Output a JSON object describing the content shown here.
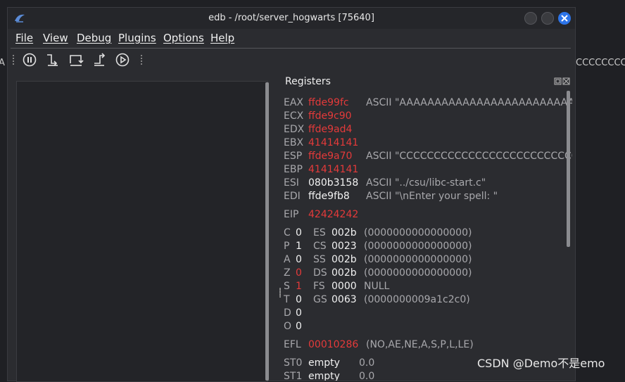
{
  "window": {
    "title": "edb - /root/server_hogwarts [75640]"
  },
  "background": {
    "left_text": "A",
    "right_text": "CCCCCCCCC"
  },
  "menu": [
    "File",
    "View",
    "Debug",
    "Plugins",
    "Options",
    "Help"
  ],
  "toolbar": [
    {
      "icon": "pause-icon"
    },
    {
      "icon": "step-into-icon"
    },
    {
      "icon": "step-over-icon"
    },
    {
      "icon": "step-out-icon"
    },
    {
      "icon": "run-icon"
    }
  ],
  "registers": {
    "title": "Registers",
    "general": [
      {
        "name": "EAX",
        "value": "ffde99fc",
        "comment": "ASCII \"AAAAAAAAAAAAAAAAAAAAAAAAAAAAAAA"
      },
      {
        "name": "ECX",
        "value": "ffde9c90",
        "comment": ""
      },
      {
        "name": "EDX",
        "value": "ffde9ad4",
        "comment": ""
      },
      {
        "name": "EBX",
        "value": "41414141",
        "comment": ""
      },
      {
        "name": "ESP",
        "value": "ffde9a70",
        "comment": "ASCII \"CCCCCCCCCCCCCCCCCCCCCCCCCCCCCC"
      },
      {
        "name": "EBP",
        "value": "41414141",
        "comment": ""
      },
      {
        "name": "ESI",
        "value": "080b3158",
        "comment": "ASCII \"../csu/libc-start.c\""
      },
      {
        "name": "EDI",
        "value": "ffde9fb8",
        "comment": "ASCII \"\\nEnter your spell: \""
      }
    ],
    "eip": {
      "name": "EIP",
      "value": "42424242"
    },
    "flags": [
      {
        "flag": "C",
        "value": "0",
        "seg": "ES",
        "seg_value": "002b",
        "desc": "(0000000000000000)"
      },
      {
        "flag": "P",
        "value": "1",
        "seg": "CS",
        "seg_value": "0023",
        "desc": "(0000000000000000)"
      },
      {
        "flag": "A",
        "value": "0",
        "seg": "SS",
        "seg_value": "002b",
        "desc": "(0000000000000000)"
      },
      {
        "flag": "Z",
        "value": "0",
        "seg": "DS",
        "seg_value": "002b",
        "desc": "(0000000000000000)"
      },
      {
        "flag": "S",
        "value": "1",
        "seg": "FS",
        "seg_value": "0000",
        "desc": "NULL"
      },
      {
        "flag": "T",
        "value": "0",
        "seg": "GS",
        "seg_value": "0063",
        "desc": "(0000000009a1c2c0)"
      },
      {
        "flag": "D",
        "value": "0",
        "seg": "",
        "seg_value": "",
        "desc": ""
      },
      {
        "flag": "O",
        "value": "0",
        "seg": "",
        "seg_value": "",
        "desc": ""
      }
    ],
    "efl": {
      "name": "EFL",
      "value": "00010286",
      "comment": "(NO,AE,NE,A,S,P,L,LE)"
    },
    "fpu": [
      {
        "name": "ST0",
        "status": "empty",
        "value": "0.0"
      },
      {
        "name": "ST1",
        "status": "empty",
        "value": "0.0"
      }
    ]
  },
  "watermark": "CSDN @Demo不是emo",
  "colors": {
    "changed": "#e43a3a",
    "normal": "#f2f2f2",
    "label": "#a8a8ac",
    "close_button": "#2d74e8"
  }
}
